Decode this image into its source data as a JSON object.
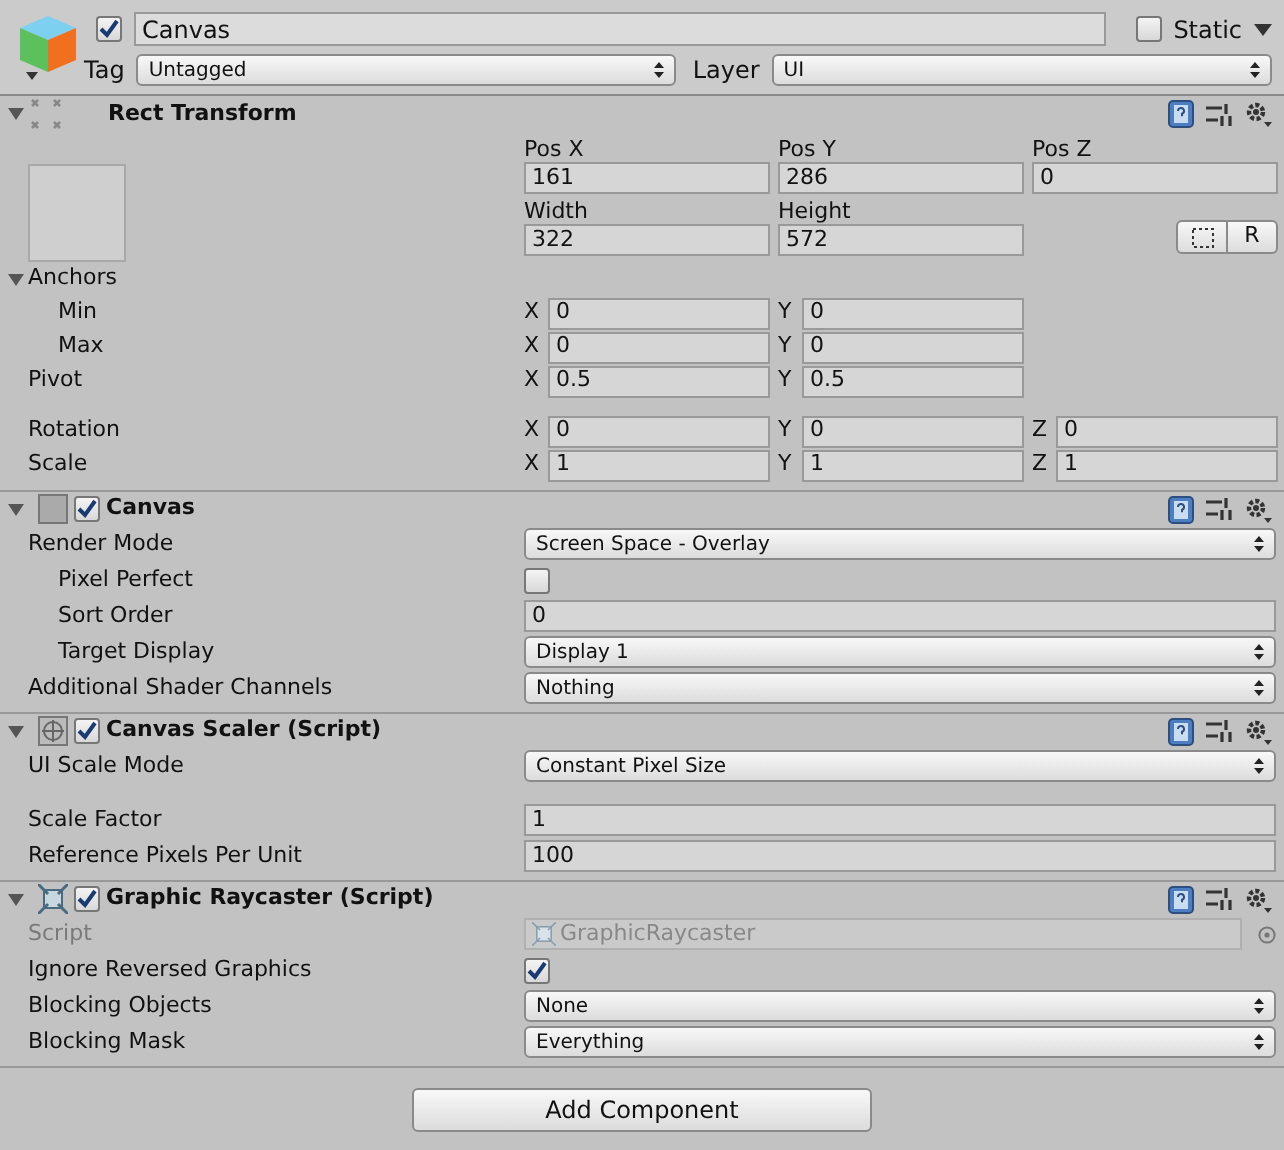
{
  "object": {
    "active": true,
    "name": "Canvas",
    "static": false,
    "static_label": "Static",
    "tag_label": "Tag",
    "tag": "Untagged",
    "layer_label": "Layer",
    "layer": "UI"
  },
  "rect_transform": {
    "title": "Rect Transform",
    "expanded": true,
    "position": [
      {
        "label": "Pos X",
        "value": "161"
      },
      {
        "label": "Pos Y",
        "value": "286"
      },
      {
        "label": "Pos Z",
        "value": "0"
      }
    ],
    "size": [
      {
        "label": "Width",
        "value": "322"
      },
      {
        "label": "Height",
        "value": "572"
      }
    ],
    "raw_button": "R",
    "rows": [
      {
        "kind": "group",
        "label": "Anchors",
        "expanded": true,
        "children": [
          {
            "kind": "vector",
            "label": "Min",
            "fields": [
              {
                "axis": "X",
                "value": "0"
              },
              {
                "axis": "Y",
                "value": "0"
              }
            ]
          },
          {
            "kind": "vector",
            "label": "Max",
            "fields": [
              {
                "axis": "X",
                "value": "0"
              },
              {
                "axis": "Y",
                "value": "0"
              }
            ]
          }
        ]
      },
      {
        "kind": "vector",
        "label": "Pivot",
        "spaced_after": true,
        "fields": [
          {
            "axis": "X",
            "value": "0.5"
          },
          {
            "axis": "Y",
            "value": "0.5"
          }
        ]
      },
      {
        "kind": "vector",
        "label": "Rotation",
        "fields": [
          {
            "axis": "X",
            "value": "0"
          },
          {
            "axis": "Y",
            "value": "0"
          },
          {
            "axis": "Z",
            "value": "0"
          }
        ]
      },
      {
        "kind": "vector",
        "label": "Scale",
        "fields": [
          {
            "axis": "X",
            "value": "1"
          },
          {
            "axis": "Y",
            "value": "1"
          },
          {
            "axis": "Z",
            "value": "1"
          }
        ]
      }
    ]
  },
  "components": [
    {
      "title": "Canvas",
      "expanded": true,
      "enabled": true,
      "rows": [
        {
          "kind": "dropdown",
          "label": "Render Mode",
          "value": "Screen Space - Overlay"
        },
        {
          "kind": "checkbox",
          "label": "Pixel Perfect",
          "indented": true,
          "checked": false
        },
        {
          "kind": "text",
          "label": "Sort Order",
          "indented": true,
          "value": "0"
        },
        {
          "kind": "dropdown",
          "label": "Target Display",
          "indented": true,
          "value": "Display 1"
        },
        {
          "kind": "dropdown",
          "label": "Additional Shader Channels",
          "value": "Nothing"
        }
      ]
    },
    {
      "title": "Canvas Scaler (Script)",
      "expanded": true,
      "enabled": true,
      "rows": [
        {
          "kind": "dropdown",
          "label": "UI Scale Mode",
          "value": "Constant Pixel Size",
          "spaced_after": true
        },
        {
          "kind": "text",
          "label": "Scale Factor",
          "value": "1"
        },
        {
          "kind": "text",
          "label": "Reference Pixels Per Unit",
          "value": "100"
        }
      ]
    },
    {
      "title": "Graphic Raycaster (Script)",
      "expanded": true,
      "enabled": true,
      "rows": [
        {
          "kind": "object",
          "label": "Script",
          "disabled": true,
          "value": "GraphicRaycaster"
        },
        {
          "kind": "checkbox",
          "label": "Ignore Reversed Graphics",
          "checked": true
        },
        {
          "kind": "dropdown",
          "label": "Blocking Objects",
          "value": "None"
        },
        {
          "kind": "dropdown",
          "label": "Blocking Mask",
          "value": "Everything"
        }
      ]
    }
  ],
  "add_component": "Add Component"
}
